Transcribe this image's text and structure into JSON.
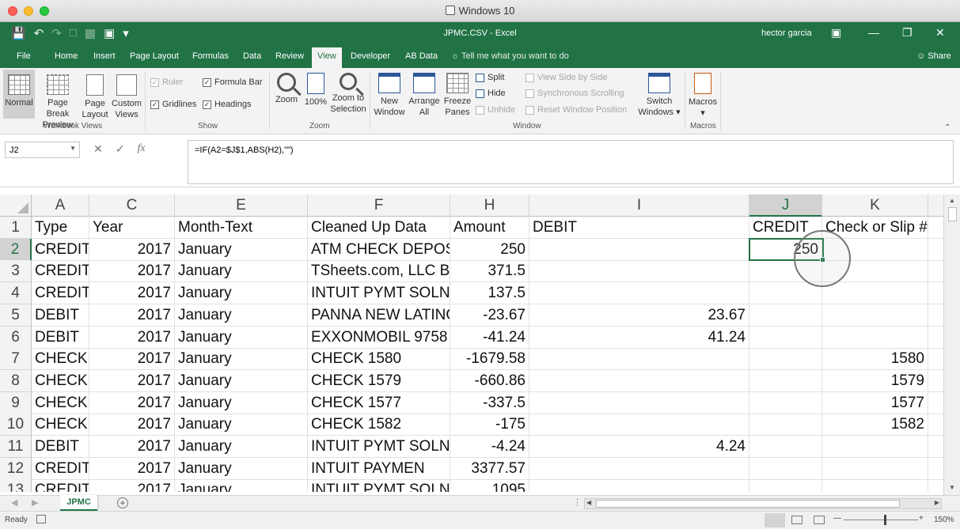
{
  "mac_window": {
    "title": "Windows 10"
  },
  "excel": {
    "doc_title": "JPMC.CSV  -  Excel",
    "user": "hector garcia",
    "tabs": [
      "File",
      "Home",
      "Insert",
      "Page Layout",
      "Formulas",
      "Data",
      "Review",
      "View",
      "Developer",
      "AB Data"
    ],
    "active_tab": "View",
    "tell_me": "Tell me what you want to do",
    "share": "Share"
  },
  "ribbon": {
    "workbook_views": {
      "label": "Workbook Views",
      "normal": "Normal",
      "page_break": "Page Break Preview",
      "page_layout": "Page Layout",
      "custom_views": "Custom Views"
    },
    "show": {
      "label": "Show",
      "ruler": "Ruler",
      "formula_bar": "Formula Bar",
      "gridlines": "Gridlines",
      "headings": "Headings"
    },
    "zoom": {
      "label": "Zoom",
      "zoom": "Zoom",
      "hundred": "100%",
      "zoom_sel": "Zoom to Selection"
    },
    "window": {
      "label": "Window",
      "new_window": "New Window",
      "arrange_all": "Arrange All",
      "freeze_panes": "Freeze Panes",
      "split": "Split",
      "hide": "Hide",
      "unhide": "Unhide",
      "view_side": "View Side by Side",
      "sync_scroll": "Synchronous Scrolling",
      "reset_pos": "Reset Window Position",
      "switch_windows": "Switch Windows"
    },
    "macros": {
      "label": "Macros",
      "macros": "Macros"
    }
  },
  "formula_bar": {
    "name_box": "J2",
    "formula": "=IF(A2=$J$1,ABS(H2),\"\")"
  },
  "grid": {
    "columns": [
      "A",
      "C",
      "E",
      "F",
      "H",
      "I",
      "J",
      "K"
    ],
    "selected_column": "J",
    "selected_row": "2",
    "rows": [
      {
        "num": "1",
        "a": "Type",
        "c": "Year",
        "e": "Month-Text",
        "f": "Cleaned Up Data",
        "h": "Amount",
        "i": "DEBIT",
        "j": "CREDIT",
        "k": "Check or Slip #"
      },
      {
        "num": "2",
        "a": "CREDIT",
        "c": "2017",
        "e": "January",
        "f": "ATM CHECK DEPOSIT",
        "h": "250",
        "i": "",
        "j": "250",
        "k": ""
      },
      {
        "num": "3",
        "a": "CREDIT",
        "c": "2017",
        "e": "January",
        "f": "TSheets.com, LLC Bill",
        "h": "371.5",
        "i": "",
        "j": "",
        "k": ""
      },
      {
        "num": "4",
        "a": "CREDIT",
        "c": "2017",
        "e": "January",
        "f": "INTUIT PYMT SOLN D",
        "h": "137.5",
        "i": "",
        "j": "",
        "k": ""
      },
      {
        "num": "5",
        "a": "DEBIT",
        "c": "2017",
        "e": "January",
        "f": "PANNA NEW LATINO",
        "h": "-23.67",
        "i": "23.67",
        "j": "",
        "k": ""
      },
      {
        "num": "6",
        "a": "DEBIT",
        "c": "2017",
        "e": "January",
        "f": "EXXONMOBIL    9758",
        "h": "-41.24",
        "i": "41.24",
        "j": "",
        "k": ""
      },
      {
        "num": "7",
        "a": "CHECK",
        "c": "2017",
        "e": "January",
        "f": "CHECK 1580",
        "h": "-1679.58",
        "i": "",
        "j": "",
        "k": "1580"
      },
      {
        "num": "8",
        "a": "CHECK",
        "c": "2017",
        "e": "January",
        "f": "CHECK 1579",
        "h": "-660.86",
        "i": "",
        "j": "",
        "k": "1579"
      },
      {
        "num": "9",
        "a": "CHECK",
        "c": "2017",
        "e": "January",
        "f": "CHECK 1577",
        "h": "-337.5",
        "i": "",
        "j": "",
        "k": "1577"
      },
      {
        "num": "10",
        "a": "CHECK",
        "c": "2017",
        "e": "January",
        "f": "CHECK 1582",
        "h": "-175",
        "i": "",
        "j": "",
        "k": "1582"
      },
      {
        "num": "11",
        "a": "DEBIT",
        "c": "2017",
        "e": "January",
        "f": "INTUIT PYMT SOLN T",
        "h": "-4.24",
        "i": "4.24",
        "j": "",
        "k": ""
      },
      {
        "num": "12",
        "a": "CREDIT",
        "c": "2017",
        "e": "January",
        "f": "INTUIT          PAYMEN",
        "h": "3377.57",
        "i": "",
        "j": "",
        "k": ""
      },
      {
        "num": "13",
        "a": "CREDIT",
        "c": "2017",
        "e": "January",
        "f": "INTUIT PYMT SOLN D",
        "h": "1095",
        "i": "",
        "j": "",
        "k": ""
      }
    ]
  },
  "sheet_tab": "JPMC",
  "status": {
    "ready": "Ready",
    "zoom": "150%"
  }
}
